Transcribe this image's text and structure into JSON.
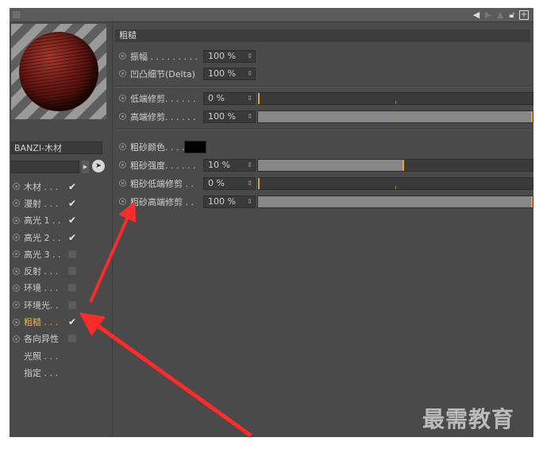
{
  "material": {
    "name": "BANZI-木材"
  },
  "channels": [
    {
      "label": "木材 . . .",
      "checked": true,
      "active": false,
      "radio": true
    },
    {
      "label": "漫射 . . .",
      "checked": true,
      "active": false,
      "radio": true
    },
    {
      "label": "高光 1 . .",
      "checked": true,
      "active": false,
      "radio": true
    },
    {
      "label": "高光 2 . .",
      "checked": true,
      "active": false,
      "radio": true
    },
    {
      "label": "高光 3 . .",
      "checked": false,
      "active": false,
      "radio": true
    },
    {
      "label": "反射 . . .",
      "checked": false,
      "active": false,
      "radio": true
    },
    {
      "label": "环境 . . .",
      "checked": false,
      "active": false,
      "radio": true
    },
    {
      "label": "环境光. .",
      "checked": false,
      "active": false,
      "radio": true
    },
    {
      "label": "粗糙 . . .",
      "checked": true,
      "active": true,
      "radio": true
    },
    {
      "label": "各向异性",
      "checked": false,
      "active": false,
      "radio": true
    },
    {
      "label": "光照 . . .",
      "checked": null,
      "active": false,
      "radio": false
    },
    {
      "label": "指定 . . .",
      "checked": null,
      "active": false,
      "radio": false
    }
  ],
  "section": {
    "title": "粗糙"
  },
  "params": {
    "amplitude": {
      "label": "振幅 . . . . . . . . .",
      "value": "100 %"
    },
    "bump_detail": {
      "label": "凹凸细节(Delta)",
      "value": "100 %"
    },
    "low_clip": {
      "label": "低端修剪. . . . . .",
      "value": "0 %",
      "fraction": 0.0
    },
    "high_clip": {
      "label": "高端修剪. . . . . .",
      "value": "100 %",
      "fraction": 1.0
    },
    "grit_color": {
      "label": "粗砂颜色. . . .",
      "color": "#000000"
    },
    "grit_strength": {
      "label": "粗砂强度. . . . . .",
      "value": "10 %",
      "fraction": 0.53
    },
    "grit_low_clip": {
      "label": "粗砂低端修剪 . .",
      "value": "0 %",
      "fraction": 0.0
    },
    "grit_high_clip": {
      "label": "粗砂高端修剪 . .",
      "value": "100 %",
      "fraction": 1.0
    }
  },
  "watermark": "最需教育",
  "colors": {
    "accent": "#f0a030",
    "arrow": "#ff2a2a",
    "panel": "#4a4a4a"
  }
}
